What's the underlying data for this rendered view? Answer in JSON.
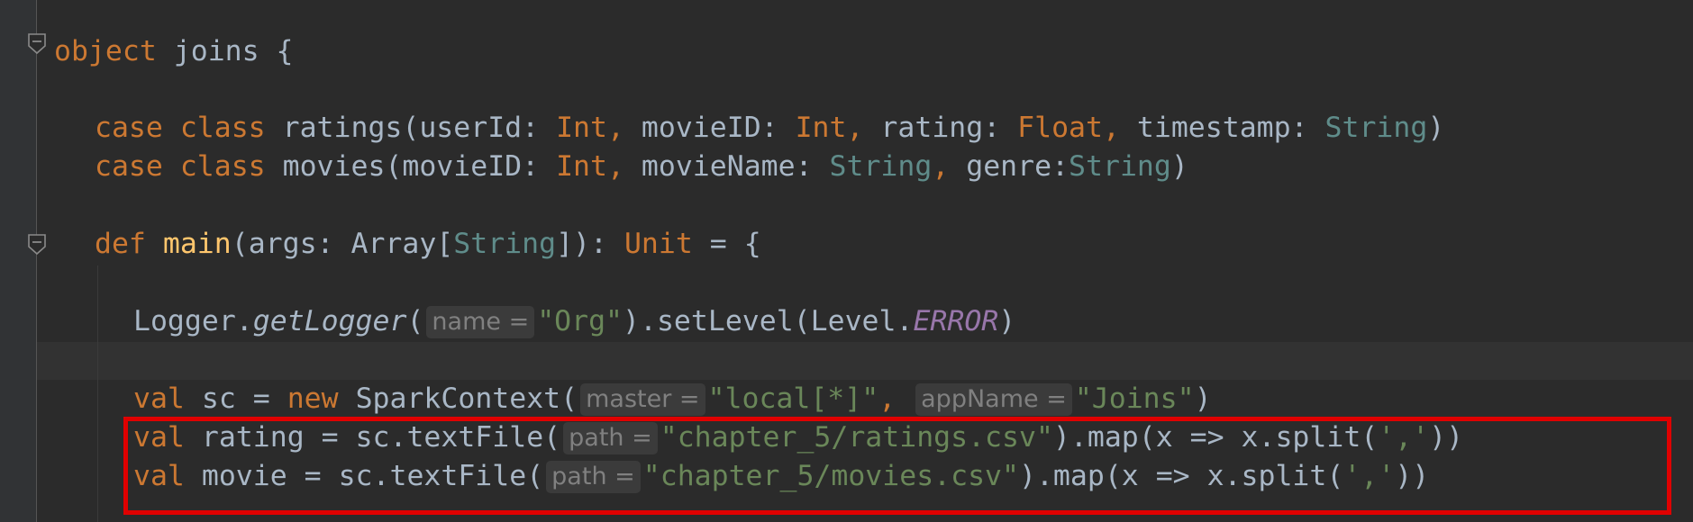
{
  "code": {
    "line1": {
      "kw": "object",
      "rest": " joins {"
    },
    "line2": {
      "kw1": "case",
      "kw2": " class",
      "name": " ratings(userId: ",
      "t1": "Int",
      "c1": ",",
      "p2": " movieID: ",
      "t2": "Int",
      "c2": ",",
      "p3": " rating: ",
      "t3": "Float",
      "c3": ",",
      "p4": " timestamp: ",
      "t4": "String",
      "end": ")"
    },
    "line3": {
      "kw1": "case",
      "kw2": " class",
      "name": " movies(movieID: ",
      "t1": "Int",
      "c1": ",",
      "p2": " movieName: ",
      "t2": "String",
      "c2": ",",
      "p3": " genre:",
      "t3": "String",
      "end": ")"
    },
    "line4": {
      "kw": "def",
      "fn": " main",
      "a": "(args: Array[",
      "t": "String",
      "b": "]): ",
      "unit": "Unit",
      "end": " = {"
    },
    "line5": {
      "a": "Logger.",
      "m": "getLogger",
      "b": "(",
      "hint": "name =",
      "s": "\"Org\"",
      "c": ").setLevel(Level.",
      "e": "ERROR",
      "d": ")"
    },
    "line6": {
      "kw": "val",
      "a": " sc = ",
      "kw2": "new",
      "b": " SparkContext(",
      "hint1": "master =",
      "s1": "\"local[*]\"",
      "comma": ",",
      "hint2": "appName =",
      "s2": "\"Joins\"",
      "end": ")"
    },
    "line7": {
      "kw": "val",
      "a": " rating = sc.textFile(",
      "hint": "path =",
      "s": "\"chapter_5/ratings.csv\"",
      "b": ").map(x => x.split(",
      "s2": "','",
      "end": "))"
    },
    "line8": {
      "kw": "val",
      "a": " movie = sc.textFile(",
      "hint": "path =",
      "s": "\"chapter_5/movies.csv\"",
      "b": ").map(x => x.split(",
      "s2": "','",
      "end": "))"
    }
  },
  "colors": {
    "background": "#2b2b2b",
    "keyword": "#cc7832",
    "string": "#6a8759",
    "type": "#5f8c8a",
    "function": "#ffc66d",
    "static_field": "#9876aa",
    "highlight_box": "#e00000"
  },
  "icons": [
    "fold-marker-icon"
  ]
}
